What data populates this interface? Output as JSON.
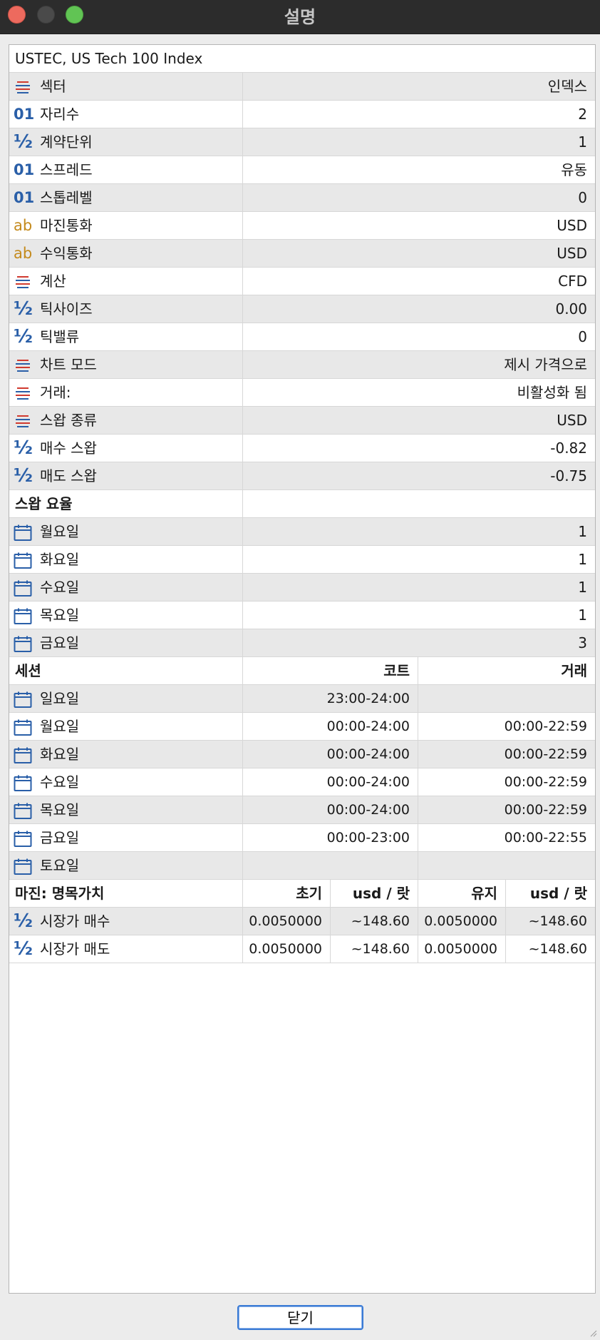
{
  "window": {
    "title": "설명",
    "close_button": "닫기"
  },
  "symbol_header": "USTEC, US Tech 100 Index",
  "properties": [
    {
      "icon": "list-icon",
      "label": "섹터",
      "value": "인덱스"
    },
    {
      "icon": "number-icon",
      "label": "자리수",
      "value": "2"
    },
    {
      "icon": "fraction-icon",
      "label": "계약단위",
      "value": "1"
    },
    {
      "icon": "number-icon",
      "label": "스프레드",
      "value": "유동"
    },
    {
      "icon": "number-icon",
      "label": "스톱레벨",
      "value": "0"
    },
    {
      "icon": "text-icon",
      "label": "마진통화",
      "value": "USD"
    },
    {
      "icon": "text-icon",
      "label": "수익통화",
      "value": "USD"
    },
    {
      "icon": "list-icon",
      "label": "계산",
      "value": "CFD"
    },
    {
      "icon": "fraction-icon",
      "label": "틱사이즈",
      "value": "0.00"
    },
    {
      "icon": "fraction-icon",
      "label": "틱밸류",
      "value": "0"
    },
    {
      "icon": "list-icon",
      "label": "차트 모드",
      "value": "제시 가격으로"
    },
    {
      "icon": "list-icon",
      "label": "거래:",
      "value": "비활성화 됨"
    },
    {
      "icon": "list-icon",
      "label": "스왑 종류",
      "value": "USD"
    },
    {
      "icon": "fraction-icon",
      "label": "매수 스왑",
      "value": "-0.82"
    },
    {
      "icon": "fraction-icon",
      "label": "매도 스왑",
      "value": "-0.75"
    }
  ],
  "swap_rates": {
    "header": "스왑 요율",
    "rows": [
      {
        "label": "월요일",
        "value": "1"
      },
      {
        "label": "화요일",
        "value": "1"
      },
      {
        "label": "수요일",
        "value": "1"
      },
      {
        "label": "목요일",
        "value": "1"
      },
      {
        "label": "금요일",
        "value": "3"
      }
    ]
  },
  "sessions": {
    "header": "세션",
    "col_quote": "코트",
    "col_trade": "거래",
    "rows": [
      {
        "label": "일요일",
        "quote": "23:00-24:00",
        "trade": ""
      },
      {
        "label": "월요일",
        "quote": "00:00-24:00",
        "trade": "00:00-22:59"
      },
      {
        "label": "화요일",
        "quote": "00:00-24:00",
        "trade": "00:00-22:59"
      },
      {
        "label": "수요일",
        "quote": "00:00-24:00",
        "trade": "00:00-22:59"
      },
      {
        "label": "목요일",
        "quote": "00:00-24:00",
        "trade": "00:00-22:59"
      },
      {
        "label": "금요일",
        "quote": "00:00-23:00",
        "trade": "00:00-22:55"
      },
      {
        "label": "토요일",
        "quote": "",
        "trade": ""
      }
    ]
  },
  "margin": {
    "header": "마진: 명목가치",
    "col_initial": "초기",
    "col_initial_unit": "usd / 랏",
    "col_maintenance": "유지",
    "col_maintenance_unit": "usd / 랏",
    "rows": [
      {
        "label": "시장가 매수",
        "initial": "0.0050000",
        "initial_usd": "~148.60",
        "maintenance": "0.0050000",
        "maintenance_usd": "~148.60"
      },
      {
        "label": "시장가 매도",
        "initial": "0.0050000",
        "initial_usd": "~148.60",
        "maintenance": "0.0050000",
        "maintenance_usd": "~148.60"
      }
    ]
  },
  "colors": {
    "icon_blue": "#2a5fa8",
    "icon_red": "#d03a2f",
    "icon_orange": "#c48a1c",
    "row_shade": "#e8e8e8",
    "button_focus": "#3a7bd5"
  }
}
